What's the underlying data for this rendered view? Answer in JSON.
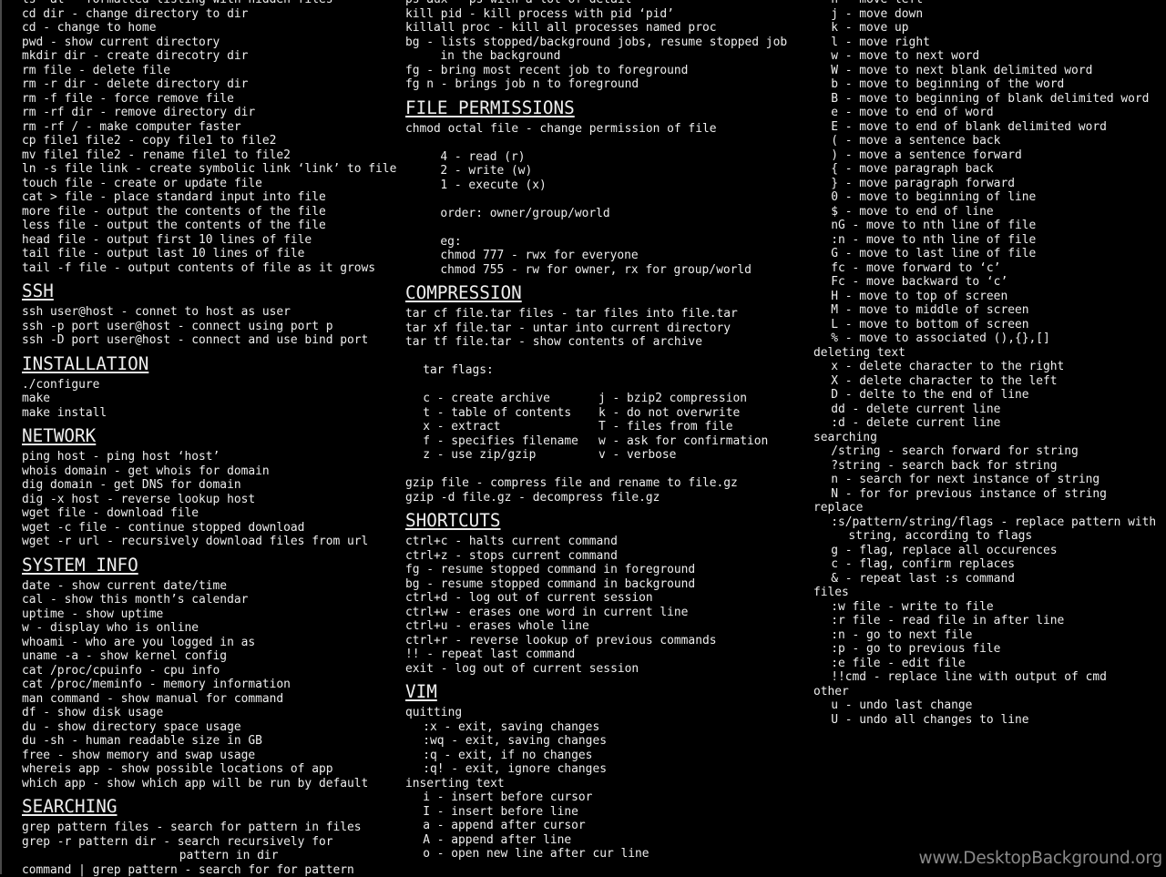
{
  "watermark": "www.DesktopBackground.org",
  "colors": {
    "background": "#000000",
    "text": "#eeeeee",
    "watermark": "#8a8a8a"
  },
  "columns": [
    {
      "items": [
        {
          "t": "ls -al - formatted listing with hidden files"
        },
        {
          "t": "cd dir - change directory to dir"
        },
        {
          "t": "cd - change to home"
        },
        {
          "t": "pwd - show current directory"
        },
        {
          "t": "mkdir dir - create direcotry dir"
        },
        {
          "t": "rm file - delete file"
        },
        {
          "t": "rm -r dir - delete directory dir"
        },
        {
          "t": "rm -f file - force remove file"
        },
        {
          "t": "rm -rf dir - remove directory dir"
        },
        {
          "t": "rm -rf / - make computer faster"
        },
        {
          "t": "cp file1 file2 - copy file1 to file2"
        },
        {
          "t": "mv file1 file2 - rename file1 to file2"
        },
        {
          "t": "ln -s file link - create symbolic link ‘link’ to file"
        },
        {
          "t": "touch file - create or update file"
        },
        {
          "t": "cat > file - place standard input into file"
        },
        {
          "t": "more file - output the contents of the file"
        },
        {
          "t": "less file - output the contents of the file"
        },
        {
          "t": "head file - output first 10 lines of file"
        },
        {
          "t": "tail file - output last 10 lines of file"
        },
        {
          "t": "tail -f file - output contents of file as it grows"
        },
        {
          "h": "SSH"
        },
        {
          "t": "ssh user@host - connet to host as user"
        },
        {
          "t": "ssh -p port user@host - connect using port p"
        },
        {
          "t": "ssh -D port user@host - connect and use bind port"
        },
        {
          "h": "INSTALLATION"
        },
        {
          "t": "./configure"
        },
        {
          "t": "make"
        },
        {
          "t": "make install"
        },
        {
          "h": "NETWORK"
        },
        {
          "t": "ping host - ping host ‘host’"
        },
        {
          "t": "whois domain - get whois for domain"
        },
        {
          "t": "dig domain - get DNS for domain"
        },
        {
          "t": "dig -x host - reverse lookup host"
        },
        {
          "t": "wget file - download file"
        },
        {
          "t": "wget -c file - continue stopped download"
        },
        {
          "t": "wget -r url - recursively download files from url"
        },
        {
          "h": "SYSTEM INFO"
        },
        {
          "t": "date - show current date/time"
        },
        {
          "t": "cal - show this month’s calendar"
        },
        {
          "t": "uptime - show uptime"
        },
        {
          "t": "w - display who is online"
        },
        {
          "t": "whoami - who are you logged in as"
        },
        {
          "t": "uname -a - show kernel config"
        },
        {
          "t": "cat /proc/cpuinfo - cpu info"
        },
        {
          "t": "cat /proc/meminfo - memory information"
        },
        {
          "t": "man command - show manual for command"
        },
        {
          "t": "df - show disk usage"
        },
        {
          "t": "du - show directory space usage"
        },
        {
          "t": "du -sh - human readable size in GB"
        },
        {
          "t": "free - show memory and swap usage"
        },
        {
          "t": "whereis app - show possible locations of app"
        },
        {
          "t": "which app - show which app will be run by default"
        },
        {
          "h": "SEARCHING"
        },
        {
          "t": "grep pattern files - search for pattern in files"
        },
        {
          "t": "grep -r pattern dir - search recursively for"
        },
        {
          "t": "pattern in dir",
          "level": 9
        },
        {
          "t": "command | grep pattern - search for for pattern"
        }
      ]
    },
    {
      "items": [
        {
          "t": "ps aux - ps with a lot of detail"
        },
        {
          "t": "kill pid - kill process with pid ‘pid’"
        },
        {
          "t": "killall proc - kill all processes named proc"
        },
        {
          "t": "bg - lists stopped/background jobs, resume stopped job"
        },
        {
          "t": "in the background",
          "level": 2
        },
        {
          "t": "fg - bring most recent job to foreground"
        },
        {
          "t": "fg n - brings job n to foreground"
        },
        {
          "h": "FILE PERMISSIONS"
        },
        {
          "t": "chmod octal file - change permission of file"
        },
        {
          "t": ""
        },
        {
          "t": "4 - read (r)",
          "level": 2
        },
        {
          "t": "2 - write (w)",
          "level": 2
        },
        {
          "t": "1 - execute (x)",
          "level": 2
        },
        {
          "t": ""
        },
        {
          "t": "order: owner/group/world",
          "level": 2
        },
        {
          "t": ""
        },
        {
          "t": "eg:",
          "level": 2
        },
        {
          "t": "chmod 777 - rwx for everyone",
          "level": 2
        },
        {
          "t": "chmod 755 - rw for owner, rx for group/world",
          "level": 2
        },
        {
          "h": "COMPRESSION"
        },
        {
          "t": "tar cf file.tar files - tar files into file.tar"
        },
        {
          "t": "tar xf file.tar - untar into current directory"
        },
        {
          "t": "tar tf file.tar - show contents of archive"
        },
        {
          "t": ""
        },
        {
          "t": "tar flags:",
          "level": 1
        },
        {
          "t": ""
        },
        {
          "cols": [
            "c - create archive",
            "j - bzip2 compression"
          ],
          "level": 1
        },
        {
          "cols": [
            "t - table of contents",
            "k - do not overwrite"
          ],
          "level": 1
        },
        {
          "cols": [
            "x - extract",
            "T - files from file"
          ],
          "level": 1
        },
        {
          "cols": [
            "f - specifies filename",
            "w - ask for confirmation"
          ],
          "level": 1
        },
        {
          "cols": [
            "z - use zip/gzip",
            "v - verbose"
          ],
          "level": 1
        },
        {
          "t": ""
        },
        {
          "t": "gzip file - compress file and rename to file.gz"
        },
        {
          "t": "gzip -d file.gz - decompress file.gz"
        },
        {
          "h": "SHORTCUTS"
        },
        {
          "t": "ctrl+c - halts current command"
        },
        {
          "t": "ctrl+z - stops current command"
        },
        {
          "t": "fg - resume stopped command in foreground"
        },
        {
          "t": "bg - resume stopped command in background"
        },
        {
          "t": "ctrl+d - log out of current session"
        },
        {
          "t": "ctrl+w - erases one word in current line"
        },
        {
          "t": "ctrl+u - erases whole line"
        },
        {
          "t": "ctrl+r - reverse lookup of previous commands"
        },
        {
          "t": "!! - repeat last command"
        },
        {
          "t": "exit - log out of current session"
        },
        {
          "h": "VIM"
        },
        {
          "t": "quitting"
        },
        {
          "t": ":x - exit, saving changes",
          "level": 1
        },
        {
          "t": ":wq - exit, saving changes",
          "level": 1
        },
        {
          "t": ":q - exit, if no changes",
          "level": 1
        },
        {
          "t": ":q! - exit, ignore changes",
          "level": 1
        },
        {
          "t": "inserting text"
        },
        {
          "t": "i - insert before cursor",
          "level": 1
        },
        {
          "t": "I - insert before line",
          "level": 1
        },
        {
          "t": "a - append after cursor",
          "level": 1
        },
        {
          "t": "A - append after line",
          "level": 1
        },
        {
          "t": "o - open new line after cur line",
          "level": 1
        }
      ]
    },
    {
      "items": [
        {
          "t": "h - move left",
          "level": 1
        },
        {
          "t": "j - move down",
          "level": 1
        },
        {
          "t": "k - move up",
          "level": 1
        },
        {
          "t": "l - move right",
          "level": 1
        },
        {
          "t": "w - move to next word",
          "level": 1
        },
        {
          "t": "W - move to next blank delimited word",
          "level": 1
        },
        {
          "t": "b - move to beginning of the word",
          "level": 1
        },
        {
          "t": "B - move to beginning of blank delimited word",
          "level": 1
        },
        {
          "t": "e - move to end of word",
          "level": 1
        },
        {
          "t": "E - move to end of blank delimited word",
          "level": 1
        },
        {
          "t": "( - move a sentence back",
          "level": 1
        },
        {
          "t": ") - move a sentence forward",
          "level": 1
        },
        {
          "t": "{ - move paragraph back",
          "level": 1
        },
        {
          "t": "} - move paragraph forward",
          "level": 1
        },
        {
          "t": "0 - move to beginning of line",
          "level": 1
        },
        {
          "t": "$ - move to end of line",
          "level": 1
        },
        {
          "t": "nG - move to nth line of file",
          "level": 1
        },
        {
          "t": ":n - move to nth line of file",
          "level": 1
        },
        {
          "t": "G - move to last line of file",
          "level": 1
        },
        {
          "t": "fc - move forward to ‘c’",
          "level": 1
        },
        {
          "t": "Fc - move backward to ‘c’",
          "level": 1
        },
        {
          "t": "H - move to top of screen",
          "level": 1
        },
        {
          "t": "M - move to middle of screen",
          "level": 1
        },
        {
          "t": "L - move to bottom of screen",
          "level": 1
        },
        {
          "t": "% - move to associated (),{},[]",
          "level": 1
        },
        {
          "t": "deleting text"
        },
        {
          "t": "x - delete character to the right",
          "level": 1
        },
        {
          "t": "X - delete character to the left",
          "level": 1
        },
        {
          "t": "D - delte to the end of line",
          "level": 1
        },
        {
          "t": "dd - delete current line",
          "level": 1
        },
        {
          "t": ":d - delete current line",
          "level": 1
        },
        {
          "t": "searching"
        },
        {
          "t": "/string - search forward for string",
          "level": 1
        },
        {
          "t": "?string - search back for string",
          "level": 1
        },
        {
          "t": "n - search for next instance of string",
          "level": 1
        },
        {
          "t": "N - for for previous instance of string",
          "level": 1
        },
        {
          "t": "replace"
        },
        {
          "t": ":s/pattern/string/flags - replace pattern with",
          "level": 1
        },
        {
          "t": "string, according to flags",
          "level": 2
        },
        {
          "t": "g - flag, replace all occurences",
          "level": 1
        },
        {
          "t": "c - flag, confirm replaces",
          "level": 1
        },
        {
          "t": "& - repeat last :s command",
          "level": 1
        },
        {
          "t": "files"
        },
        {
          "t": ":w file - write to file",
          "level": 1
        },
        {
          "t": ":r file - read file in after line",
          "level": 1
        },
        {
          "t": ":n - go to next file",
          "level": 1
        },
        {
          "t": ":p - go to previous file",
          "level": 1
        },
        {
          "t": ":e file - edit file",
          "level": 1
        },
        {
          "t": "!!cmd - replace line with output of cmd",
          "level": 1
        },
        {
          "t": "other"
        },
        {
          "t": "u - undo last change",
          "level": 1
        },
        {
          "t": "U - undo all changes to line",
          "level": 1
        }
      ]
    }
  ]
}
